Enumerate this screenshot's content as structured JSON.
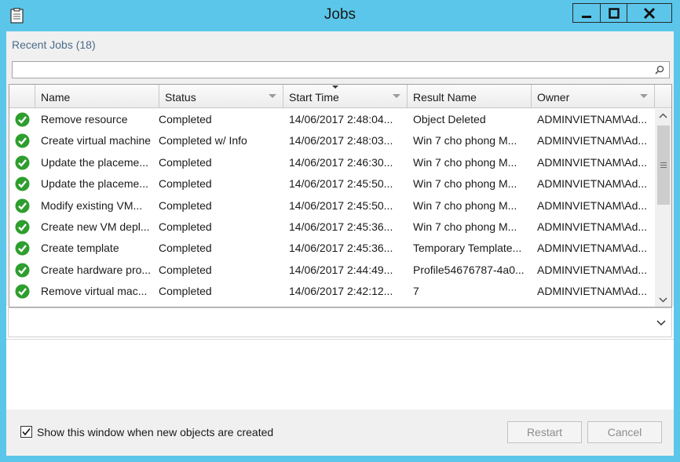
{
  "window": {
    "title": "Jobs",
    "minimize_icon": "minimize-icon",
    "maximize_icon": "maximize-icon",
    "close_icon": "close-icon"
  },
  "recent_jobs_label": "Recent Jobs (18)",
  "search": {
    "value": "",
    "placeholder": ""
  },
  "columns": [
    "Name",
    "Status",
    "Start Time",
    "Result Name",
    "Owner"
  ],
  "sorted_column": "Start Time",
  "jobs": [
    {
      "name": "Remove resource",
      "status": "Completed",
      "start_time": "14/06/2017 2:48:04...",
      "result_name": "Object Deleted",
      "owner": "ADMINVIETNAM\\Ad..."
    },
    {
      "name": "Create virtual machine",
      "status": "Completed w/ Info",
      "start_time": "14/06/2017 2:48:03...",
      "result_name": "Win 7 cho phong M...",
      "owner": "ADMINVIETNAM\\Ad..."
    },
    {
      "name": "Update the placeme...",
      "status": "Completed",
      "start_time": "14/06/2017 2:46:30...",
      "result_name": "Win 7 cho phong M...",
      "owner": "ADMINVIETNAM\\Ad..."
    },
    {
      "name": "Update the placeme...",
      "status": "Completed",
      "start_time": "14/06/2017 2:45:50...",
      "result_name": "Win 7 cho phong M...",
      "owner": "ADMINVIETNAM\\Ad..."
    },
    {
      "name": "Modify existing VM...",
      "status": "Completed",
      "start_time": "14/06/2017 2:45:50...",
      "result_name": "Win 7 cho phong M...",
      "owner": "ADMINVIETNAM\\Ad..."
    },
    {
      "name": "Create new VM depl...",
      "status": "Completed",
      "start_time": "14/06/2017 2:45:36...",
      "result_name": "Win 7 cho phong M...",
      "owner": "ADMINVIETNAM\\Ad..."
    },
    {
      "name": "Create template",
      "status": "Completed",
      "start_time": "14/06/2017 2:45:36...",
      "result_name": "Temporary Template...",
      "owner": "ADMINVIETNAM\\Ad..."
    },
    {
      "name": "Create hardware pro...",
      "status": "Completed",
      "start_time": "14/06/2017 2:44:49...",
      "result_name": "Profile54676787-4a0...",
      "owner": "ADMINVIETNAM\\Ad..."
    },
    {
      "name": "Remove virtual mac...",
      "status": "Completed",
      "start_time": "14/06/2017 2:42:12...",
      "result_name": "7",
      "owner": "ADMINVIETNAM\\Ad..."
    }
  ],
  "footer": {
    "show_window_label": "Show this window when new objects are created",
    "show_window_checked": true,
    "restart_label": "Restart",
    "cancel_label": "Cancel"
  },
  "colors": {
    "title_bar": "#5bc6ea",
    "status_ok": "#2e9e2e",
    "section_label": "#4d6b8a"
  }
}
